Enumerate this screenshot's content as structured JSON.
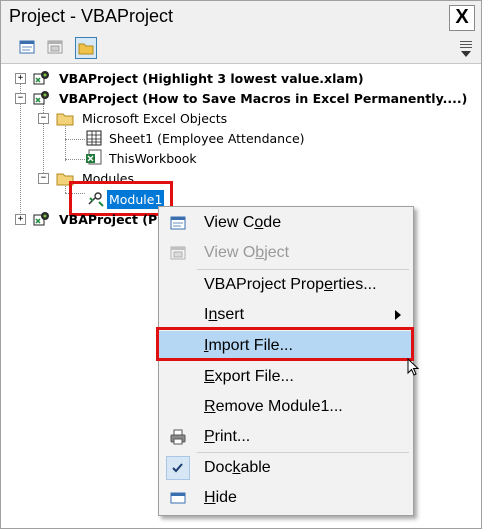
{
  "window": {
    "title": "Project - VBAProject",
    "close_label": "X"
  },
  "toolbar": {
    "buttons": [
      "view-code",
      "view-object",
      "toggle-folders"
    ]
  },
  "tree": {
    "nodes": [
      {
        "label": "VBAProject (Highlight 3 lowest value.xlam)",
        "expander": "+"
      },
      {
        "label": "VBAProject (How to Save Macros in Excel Permanently....)",
        "expander": "−"
      },
      {
        "label": "Microsoft Excel Objects",
        "expander": "−"
      },
      {
        "label": "Sheet1 (Employee Attendance)"
      },
      {
        "label": "ThisWorkbook"
      },
      {
        "label": "Modules",
        "expander": "−"
      },
      {
        "label": "Module1",
        "selected": true
      },
      {
        "label": "VBAProject (PE",
        "expander": "+"
      }
    ]
  },
  "context_menu": {
    "items": [
      {
        "pre": "View C",
        "u": "o",
        "post": "de",
        "icon": "view-code-icon",
        "disabled": false
      },
      {
        "pre": "View O",
        "u": "b",
        "post": "ject",
        "icon": "view-object-icon",
        "disabled": true
      },
      {
        "pre": "VBAProject Prop",
        "u": "e",
        "post": "rties...",
        "disabled": false
      },
      {
        "pre": "I",
        "u": "n",
        "post": "sert",
        "disabled": false,
        "submenu": true
      },
      {
        "pre": "",
        "u": "I",
        "post": "mport File...",
        "disabled": false,
        "highlighted": true
      },
      {
        "pre": "",
        "u": "E",
        "post": "xport File...",
        "disabled": false
      },
      {
        "pre": "",
        "u": "R",
        "post": "emove Module1...",
        "disabled": false
      },
      {
        "pre": "",
        "u": "P",
        "post": "rint...",
        "icon": "printer-icon",
        "disabled": false
      },
      {
        "pre": "Doc",
        "u": "k",
        "post": "able",
        "icon": "checkmark-icon",
        "disabled": false
      },
      {
        "pre": "",
        "u": "H",
        "post": "ide",
        "icon": "hide-window-icon",
        "disabled": false
      }
    ]
  },
  "colors": {
    "selection": "#0078d7",
    "highlight": "#b5d7f3",
    "callout": "#e01010"
  }
}
